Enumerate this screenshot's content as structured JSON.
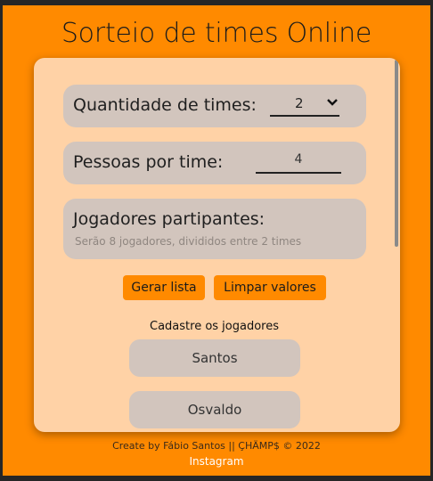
{
  "page": {
    "title": "Sorteio de times Online"
  },
  "form": {
    "teams_label": "Quantidade de times:",
    "teams_value": "2",
    "people_label": "Pessoas por time:",
    "people_value": "4",
    "players_title": "Jogadores partipantes:",
    "players_summary": "Serão 8 jogadores, divididos entre 2 times"
  },
  "actions": {
    "generate_label": "Gerar lista",
    "clear_label": "Limpar valores"
  },
  "register": {
    "title": "Cadastre os jogadores",
    "players": [
      "Santos",
      "Osvaldo"
    ]
  },
  "footer": {
    "credit": "Create by Fábio Santos || ÇHÄMP$ © 2022",
    "link": "Instagram"
  },
  "colors": {
    "accent": "#ff8a00",
    "card": "#ffd2a6",
    "pill": "#d2c5bd"
  },
  "icons": {
    "select_arrow": "chevron-down-icon"
  }
}
